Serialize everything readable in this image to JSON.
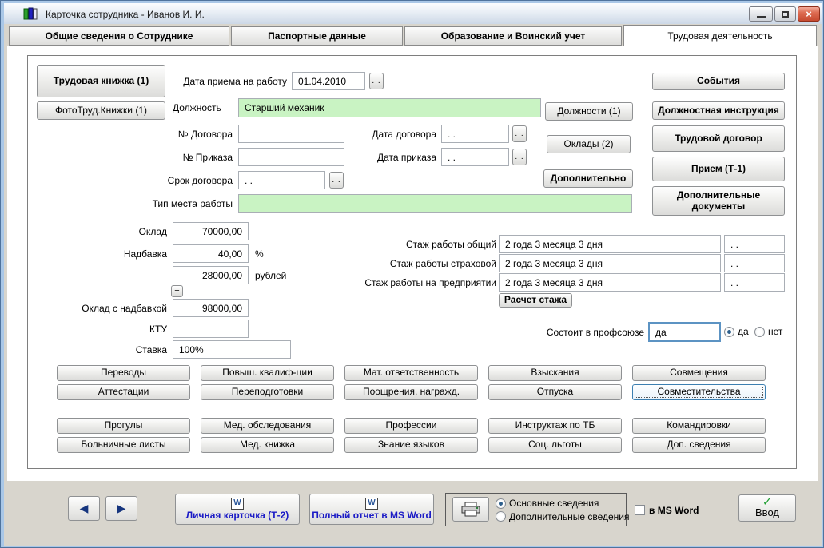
{
  "colors": {
    "green_field": "#c9f3c3",
    "focus_blue": "#5c93c3",
    "link_blue": "#1b1bc6",
    "check_green": "#1f9e32",
    "window_bg": "#d8d5cd",
    "frame_blue": "#a9c7e7"
  },
  "window": {
    "title": "Карточка сотрудника -  Иванов И. И.",
    "controls": {
      "minimize": "minimize",
      "maximize": "maximize",
      "close": "close"
    }
  },
  "tabs": [
    {
      "label": "Общие сведения о Сотруднике",
      "active": false
    },
    {
      "label": "Паспортные данные",
      "active": false
    },
    {
      "label": "Образование и Воинский учет",
      "active": false
    },
    {
      "label": "Трудовая деятельность",
      "active": true
    }
  ],
  "left_buttons": {
    "workbook": "Трудовая книжка (1)",
    "photos": "ФотоТруд.Книжки (1)"
  },
  "form": {
    "hire_date": {
      "label": "Дата приема на работу",
      "value": "01.04.2010",
      "browse": "..."
    },
    "position": {
      "label": "Должность",
      "value": "Старший механик"
    },
    "contract_no": {
      "label": "№ Договора",
      "value": ""
    },
    "contract_date": {
      "label": "Дата договора",
      "value": ".  .",
      "browse": "..."
    },
    "order_no": {
      "label": "№ Приказа",
      "value": ""
    },
    "order_date": {
      "label": "Дата приказа",
      "value": ".  .",
      "browse": "..."
    },
    "contract_term": {
      "label": "Срок договора",
      "value": ".  .",
      "browse": "..."
    },
    "workplace_type": {
      "label": "Тип места работы",
      "value": ""
    }
  },
  "side_buttons": {
    "positions": "Должности (1)",
    "salaries": "Оклады (2)",
    "additional": "Дополнительно"
  },
  "right_buttons": {
    "events": "События",
    "job_description": "Должностная инструкция",
    "employment_contract": "Трудовой  договор",
    "hiring": "Прием (Т-1)",
    "additional_documents": "Дополнительные документы"
  },
  "salary": {
    "base": {
      "label": "Оклад",
      "value": "70000,00"
    },
    "bonus_percent": {
      "label": "Надбавка",
      "value": "40,00",
      "unit": "%"
    },
    "bonus_rub": {
      "value": "28000,00",
      "unit": "рублей"
    },
    "plus_button": "+",
    "total": {
      "label": "Оклад с надбавкой",
      "value": "98000,00"
    },
    "ktu": {
      "label": "КТУ",
      "value": ""
    },
    "rate": {
      "label": "Ставка",
      "value": "100%"
    }
  },
  "seniority": {
    "rows": [
      {
        "label": "Стаж работы общий",
        "value": "2 года 3 месяца 3 дня",
        "date": ".  ."
      },
      {
        "label": "Стаж работы страховой",
        "value": "2 года 3 месяца 3 дня",
        "date": ".  ."
      },
      {
        "label": "Стаж работы на предприятии",
        "value": "2 года 3 месяца 3 дня",
        "date": ".  ."
      }
    ],
    "calc_button": "Расчет стажа"
  },
  "union": {
    "label": "Состоит в профсоюзе",
    "value": "да",
    "options": [
      {
        "label": "да",
        "selected": true
      },
      {
        "label": "нет",
        "selected": false
      }
    ]
  },
  "grid": [
    [
      "Переводы",
      "Повыш. квалиф-ции",
      "Мат. ответственность",
      "Взыскания",
      "Совмещения"
    ],
    [
      "Аттестации",
      "Переподготовки",
      "Поощрения, награжд.",
      "Отпуска",
      "Совместительства"
    ],
    [
      "Прогулы",
      "Мед. обследования",
      "Профессии",
      "Инструктаж по ТБ",
      "Командировки"
    ],
    [
      "Больничные листы",
      "Мед. книжка",
      "Знание языков",
      "Соц. льготы",
      "Доп. сведения"
    ]
  ],
  "grid_focused": "Совместительства",
  "bottom": {
    "prev": "◀",
    "next": "▶",
    "personal_card": "Личная карточка (Т-2)",
    "full_report": "Полный отчет в MS Word",
    "print_options": [
      {
        "label": "Основные сведения",
        "selected": true
      },
      {
        "label": "Дополнительные сведения",
        "selected": false
      }
    ],
    "word_checkbox": "в MS Word",
    "enter": "Ввод",
    "check": "✓",
    "word_icon": "W"
  }
}
